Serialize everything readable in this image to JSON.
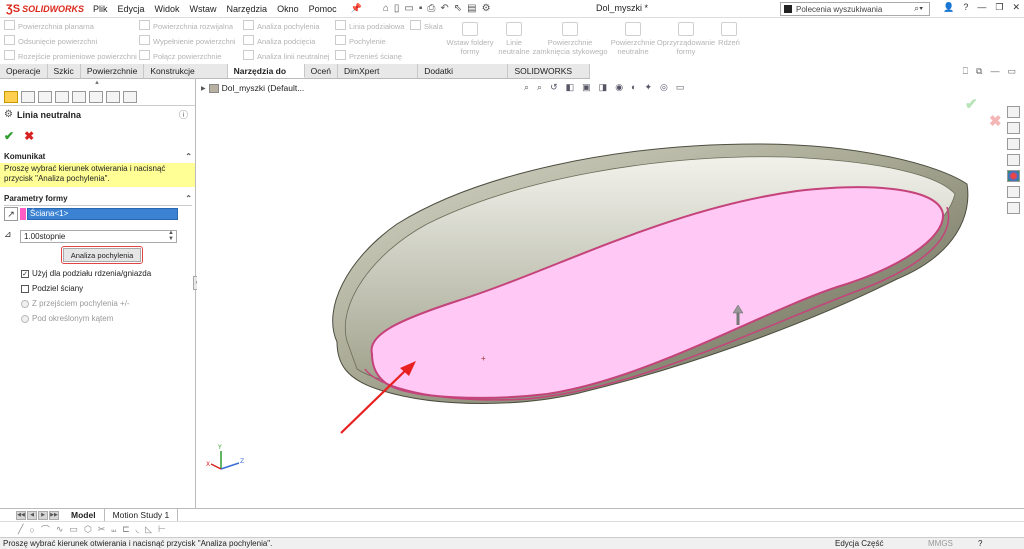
{
  "app": {
    "brand": "SOLIDWORKS",
    "brand_color": "#da291c"
  },
  "menu": [
    "Plik",
    "Edycja",
    "Widok",
    "Wstaw",
    "Narzędzia",
    "Okno",
    "Pomoc"
  ],
  "document_title": "Dol_myszki *",
  "search": {
    "placeholder": "Polecenia wyszukiwania"
  },
  "ribbon": {
    "col1": [
      "Powierzchnia planarna",
      "Odsunięcie powierzchni",
      "Rozejście promieniowe powierzchni"
    ],
    "col2": [
      "Powierzchnia rozwijalna",
      "Wypełnienie powierzchni",
      "Połącz powierzchnie"
    ],
    "col3": [
      "Analiza pochylenia",
      "Analiza podcięcia",
      "Analiza linii neutralnej"
    ],
    "col4": [
      "Linia podziałowa",
      "Pochylenie",
      "Przenieś ścianę"
    ],
    "col5": [
      "Skala"
    ],
    "big": [
      "Wstaw foldery formy",
      "Linie neutralne",
      "Powierzchnie zamknięcia stykowego",
      "Powierzchnie neutralne",
      "Oprzyrządowanie formy",
      "Rdzeń"
    ]
  },
  "command_tabs": [
    "Operacje",
    "Szkic",
    "Powierzchnie",
    "Konstrukcje spawane",
    "Narzędzia do form",
    "Oceń",
    "DimXpert Wymiarów",
    "Dodatki SOLIDWORKS",
    "SOLIDWORKS CAM"
  ],
  "active_tab": "Narzędzia do form",
  "panel": {
    "title": "Linia neutralna",
    "message_header": "Komunikat",
    "message": "Proszę wybrać kierunek otwierania i nacisnąć przycisk \"Analiza pochylenia\".",
    "params_header": "Parametry formy",
    "face": "Ściana<1>",
    "angle": "1.00stopnie",
    "analyze_button": "Analiza pochylenia",
    "options": {
      "use_core": "Użyj dla podziału rdzenia/gniazda",
      "split_faces": "Podziel ściany",
      "transition": "Z przejściem pochylenia +/-",
      "at_angle": "Pod określonym kątem"
    }
  },
  "tree": {
    "item": "Dol_myszki  (Default..."
  },
  "bottom_tabs": [
    "Model",
    "Motion Study 1"
  ],
  "status": {
    "text": "Proszę wybrać kierunek otwierania i nacisnąć przycisk \"Analiza pochylenia\".",
    "edit": "Edycja Część",
    "units": "MMGS"
  },
  "colors": {
    "highlight_face": "#ffc8f5",
    "part_color": "#a8a993",
    "arrow": "#e8201f",
    "highlight_edge": "#c4437a"
  }
}
